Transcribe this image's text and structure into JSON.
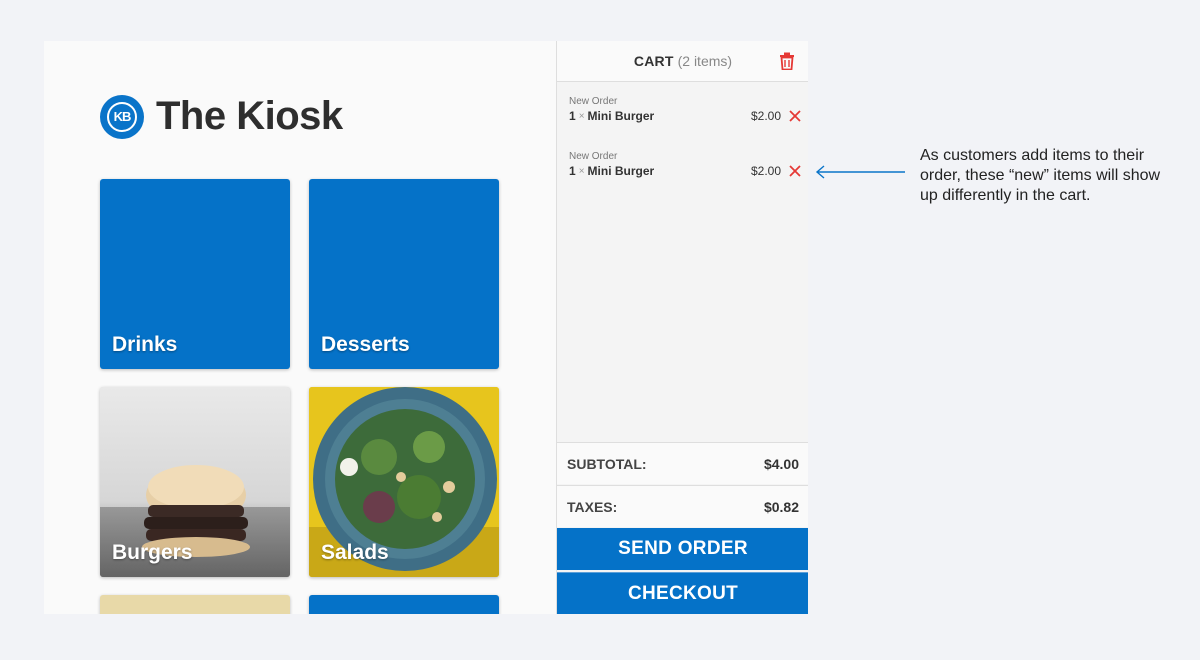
{
  "app": {
    "logo_text": "KB",
    "title": "The Kiosk"
  },
  "categories": [
    {
      "label": "Drinks"
    },
    {
      "label": "Desserts"
    },
    {
      "label": "Burgers"
    },
    {
      "label": "Salads"
    }
  ],
  "cart": {
    "title": "CART",
    "count": "(2 items)",
    "items": [
      {
        "tag": "New Order",
        "qty": "1",
        "times": "×",
        "name": "Mini Burger",
        "price": "$2.00"
      },
      {
        "tag": "New Order",
        "qty": "1",
        "times": "×",
        "name": "Mini Burger",
        "price": "$2.00"
      }
    ],
    "subtotal_label": "SUBTOTAL:",
    "subtotal_value": "$4.00",
    "taxes_label": "TAXES:",
    "taxes_value": "$0.82",
    "send_order_label": "SEND ORDER",
    "checkout_label": "CHECKOUT"
  },
  "annotation": {
    "text": "As customers add items to their order, these “new” items will show up differently in the cart."
  },
  "colors": {
    "accent": "#0572c8",
    "remove": "#e53935",
    "background": "#f2f3f7"
  }
}
